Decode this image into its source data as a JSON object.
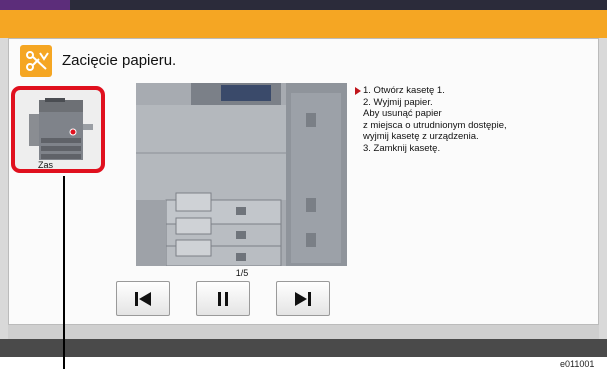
{
  "dialog": {
    "title": "Zacięcie papieru.",
    "thumbnail_label": "Zas",
    "instructions": "1. Otwórz kasetę 1.\n2. Wyjmij papier.\nAby usunąć papier\nz miejsca o utrudnionym dostępie,\nwyjmij kasetę z urządzenia.\n3. Zamknij kasetę.",
    "page_counter": "1/5"
  },
  "controls": {
    "prev_icon": "skip-back-icon",
    "pause_icon": "pause-icon",
    "next_icon": "skip-forward-icon"
  },
  "figure_code": "e011001",
  "colors": {
    "header_orange": "#f5a623",
    "highlight_red": "#e0101e",
    "arrow_red": "#c0151b"
  }
}
